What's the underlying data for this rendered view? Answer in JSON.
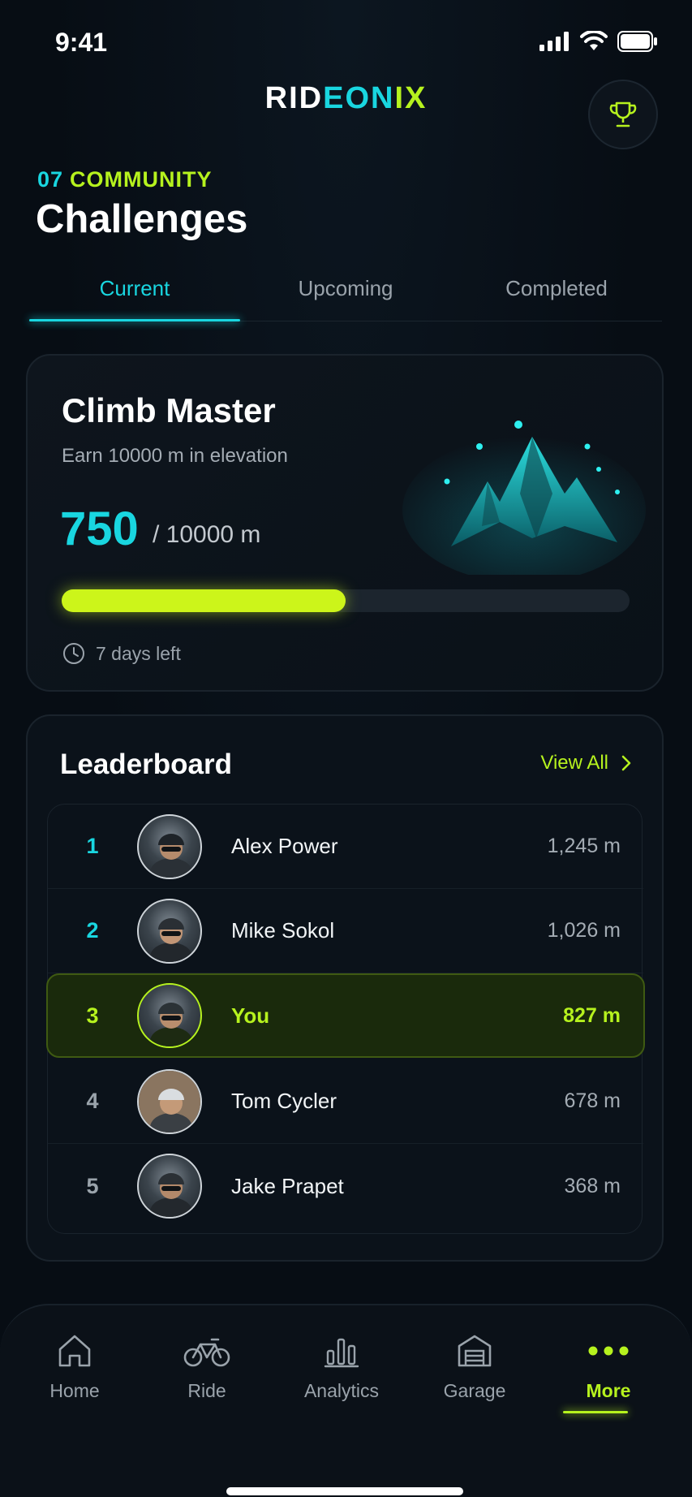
{
  "status_bar": {
    "time": "9:41"
  },
  "header": {
    "brand_part1": "RID",
    "brand_part2": "EON",
    "brand_part3": "IX",
    "section_number": "07",
    "section_label": "COMMUNITY",
    "title": "Challenges"
  },
  "tabs": [
    {
      "label": "Current",
      "active": true
    },
    {
      "label": "Upcoming",
      "active": false
    },
    {
      "label": "Completed",
      "active": false
    }
  ],
  "challenge": {
    "title": "Climb Master",
    "description": "Earn 10000 m in elevation",
    "progress_value": "750",
    "progress_total": "/ 10000 m",
    "progress_fraction": 0.5,
    "time_left": "7 days left"
  },
  "leaderboard": {
    "title": "Leaderboard",
    "view_all_label": "View All",
    "rows": [
      {
        "rank": "1",
        "name": "Alex Power",
        "distance": "1,245 m"
      },
      {
        "rank": "2",
        "name": "Mike Sokol",
        "distance": "1,026 m"
      },
      {
        "rank": "3",
        "name": "You",
        "distance": "827 m"
      },
      {
        "rank": "4",
        "name": "Tom Cycler",
        "distance": "678 m"
      },
      {
        "rank": "5",
        "name": "Jake Prapet",
        "distance": "368 m"
      }
    ]
  },
  "nav": [
    {
      "label": "Home",
      "icon": "home-icon"
    },
    {
      "label": "Ride",
      "icon": "bicycle-icon"
    },
    {
      "label": "Analytics",
      "icon": "bar-chart-icon"
    },
    {
      "label": "Garage",
      "icon": "garage-icon"
    },
    {
      "label": "More",
      "icon": "more-dots-icon",
      "active": true
    }
  ],
  "colors": {
    "accent_cyan": "#19d6e0",
    "accent_lime": "#b6f21e",
    "background": "#070d14"
  }
}
